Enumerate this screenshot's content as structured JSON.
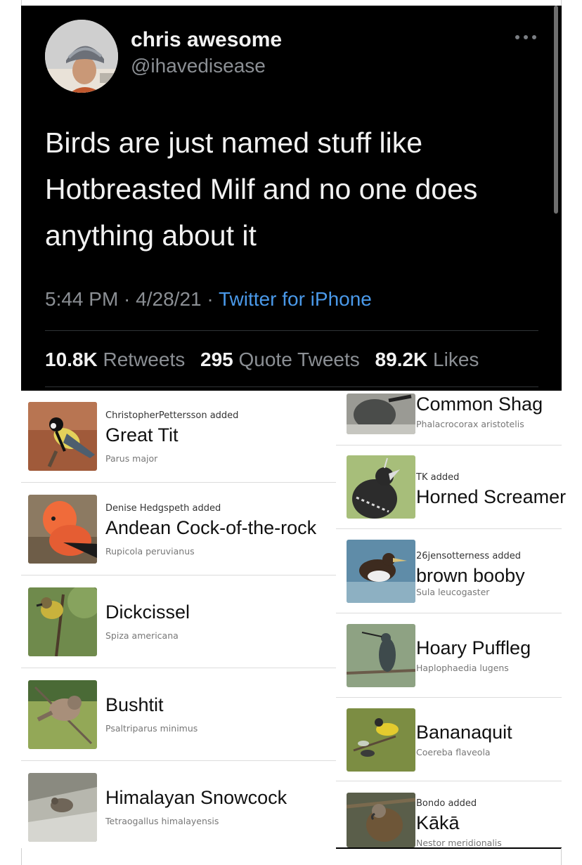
{
  "tweet": {
    "display_name": "chris awesome",
    "handle": "@ihavedisease",
    "text": "Birds are just named stuff like Hotbreasted Milf and no one does anything about it",
    "time": "5:44 PM",
    "dot1": " · ",
    "date": "4/28/21",
    "dot2": " · ",
    "source": "Twitter for iPhone",
    "stats": {
      "retweets_count": "10.8K",
      "retweets_label": "Retweets",
      "quotes_count": "295",
      "quotes_label": "Quote Tweets",
      "likes_count": "89.2K",
      "likes_label": "Likes"
    },
    "more_icon": "more-horizontal-icon",
    "colors": {
      "background": "#000000",
      "text": "#e7e9ea",
      "muted": "#8b8f94",
      "link": "#4a99e9"
    }
  },
  "birds_left": [
    {
      "added_by": "ChristopherPettersson added",
      "name": "Great Tit",
      "scientific": "Parus major"
    },
    {
      "added_by": "Denise Hedgspeth added",
      "name": "Andean Cock-of-the-rock",
      "scientific": "Rupicola peruvianus"
    },
    {
      "added_by": "",
      "name": "Dickcissel",
      "scientific": "Spiza americana"
    },
    {
      "added_by": "",
      "name": "Bushtit",
      "scientific": "Psaltriparus minimus"
    },
    {
      "added_by": "",
      "name": "Himalayan Snowcock",
      "scientific": "Tetraogallus himalayensis"
    }
  ],
  "birds_right": [
    {
      "added_by": "",
      "name": "Common Shag",
      "scientific": "Phalacrocorax aristotelis"
    },
    {
      "added_by": "TK added",
      "name": "Horned Screamer",
      "scientific": ""
    },
    {
      "added_by": "26jensotterness added",
      "name": "brown booby",
      "scientific": "Sula leucogaster"
    },
    {
      "added_by": "",
      "name": "Hoary Puffleg",
      "scientific": "Haplophaedia lugens"
    },
    {
      "added_by": "",
      "name": "Bananaquit",
      "scientific": "Coereba flaveola"
    },
    {
      "added_by": "Bondo added",
      "name": "Kākā",
      "scientific": "Nestor meridionalis"
    }
  ]
}
